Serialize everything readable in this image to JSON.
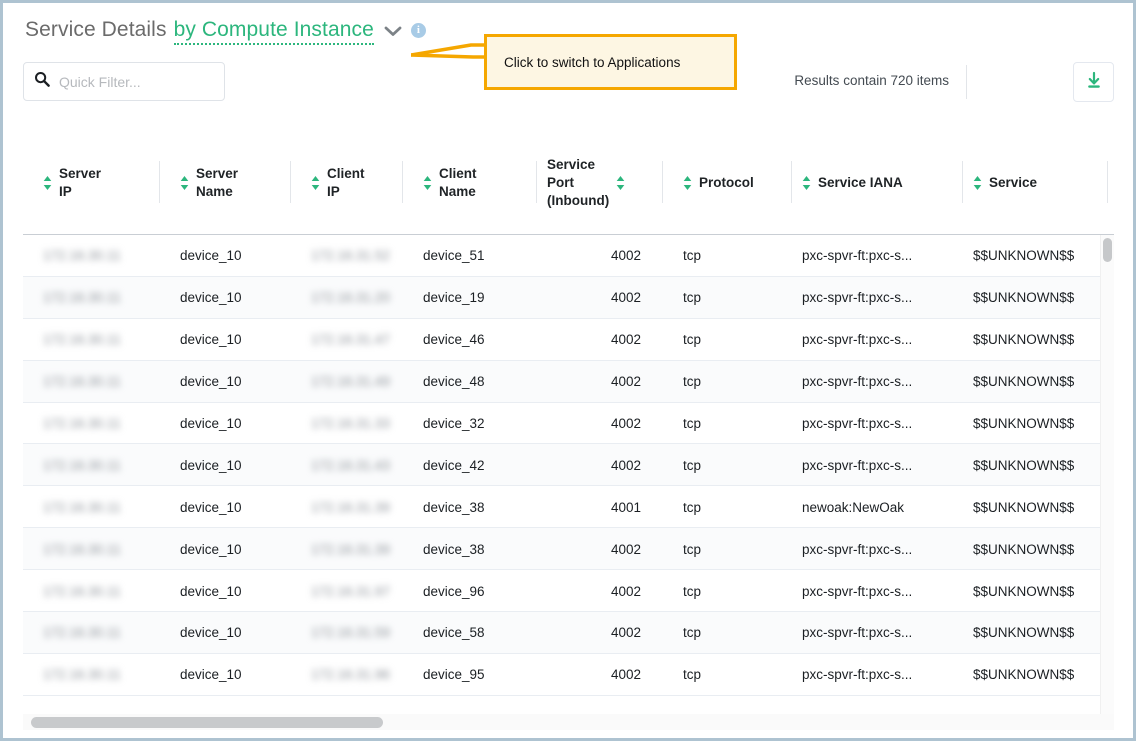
{
  "header": {
    "title_static": "Service Details",
    "title_link": "by Compute Instance",
    "chevron_icon": "chevron-down-icon",
    "info_icon": "info-icon",
    "info_glyph": "i"
  },
  "tooltip": {
    "text": "Click to switch to Applications",
    "border_color": "#f5a700",
    "background_color": "#fdf6e3"
  },
  "search": {
    "icon": "search-icon",
    "placeholder": "Quick Filter...",
    "value": ""
  },
  "toolbar": {
    "results_text": "Results contain 720 items",
    "download_icon": "download-icon",
    "accent_color": "#2cb67d"
  },
  "table": {
    "columns": [
      {
        "label": "Server\nIP",
        "line1": "Server",
        "line2": "IP",
        "sortable": true,
        "sorter_side": "left",
        "align": "left"
      },
      {
        "label": "Server\nName",
        "line1": "Server",
        "line2": "Name",
        "sortable": true,
        "sorter_side": "left",
        "align": "left"
      },
      {
        "label": "Client\nIP",
        "line1": "Client",
        "line2": "IP",
        "sortable": true,
        "sorter_side": "left",
        "align": "left"
      },
      {
        "label": "Client\nName",
        "line1": "Client",
        "line2": "Name",
        "sortable": true,
        "sorter_side": "left",
        "align": "left"
      },
      {
        "label": "Service Port (Inbound)",
        "line1": "Service",
        "line2": "Port",
        "line3": "(Inbound)",
        "sortable": true,
        "sorter_side": "right",
        "align": "right"
      },
      {
        "label": "Protocol",
        "line1": "Protocol",
        "sortable": true,
        "sorter_side": "left",
        "align": "left"
      },
      {
        "label": "Service IANA",
        "line1": "Service IANA",
        "sortable": true,
        "sorter_side": "left",
        "align": "left"
      },
      {
        "label": "Service",
        "line1": "Service",
        "sortable": true,
        "sorter_side": "left",
        "align": "left"
      }
    ],
    "rows": [
      {
        "server_ip": "172.16.30.11",
        "server_name": "device_10",
        "client_ip": "172.16.31.52",
        "client_name": "device_51",
        "service_port": "4002",
        "protocol": "tcp",
        "service_iana": "pxc-spvr-ft:pxc-s...",
        "service": "$$UNKNOWN$$"
      },
      {
        "server_ip": "172.16.30.11",
        "server_name": "device_10",
        "client_ip": "172.16.31.20",
        "client_name": "device_19",
        "service_port": "4002",
        "protocol": "tcp",
        "service_iana": "pxc-spvr-ft:pxc-s...",
        "service": "$$UNKNOWN$$"
      },
      {
        "server_ip": "172.16.30.11",
        "server_name": "device_10",
        "client_ip": "172.16.31.47",
        "client_name": "device_46",
        "service_port": "4002",
        "protocol": "tcp",
        "service_iana": "pxc-spvr-ft:pxc-s...",
        "service": "$$UNKNOWN$$"
      },
      {
        "server_ip": "172.16.30.11",
        "server_name": "device_10",
        "client_ip": "172.16.31.49",
        "client_name": "device_48",
        "service_port": "4002",
        "protocol": "tcp",
        "service_iana": "pxc-spvr-ft:pxc-s...",
        "service": "$$UNKNOWN$$"
      },
      {
        "server_ip": "172.16.30.11",
        "server_name": "device_10",
        "client_ip": "172.16.31.33",
        "client_name": "device_32",
        "service_port": "4002",
        "protocol": "tcp",
        "service_iana": "pxc-spvr-ft:pxc-s...",
        "service": "$$UNKNOWN$$"
      },
      {
        "server_ip": "172.16.30.11",
        "server_name": "device_10",
        "client_ip": "172.16.31.43",
        "client_name": "device_42",
        "service_port": "4002",
        "protocol": "tcp",
        "service_iana": "pxc-spvr-ft:pxc-s...",
        "service": "$$UNKNOWN$$"
      },
      {
        "server_ip": "172.16.30.11",
        "server_name": "device_10",
        "client_ip": "172.16.31.39",
        "client_name": "device_38",
        "service_port": "4001",
        "protocol": "tcp",
        "service_iana": "newoak:NewOak",
        "service": "$$UNKNOWN$$"
      },
      {
        "server_ip": "172.16.30.11",
        "server_name": "device_10",
        "client_ip": "172.16.31.39",
        "client_name": "device_38",
        "service_port": "4002",
        "protocol": "tcp",
        "service_iana": "pxc-spvr-ft:pxc-s...",
        "service": "$$UNKNOWN$$"
      },
      {
        "server_ip": "172.16.30.11",
        "server_name": "device_10",
        "client_ip": "172.16.31.97",
        "client_name": "device_96",
        "service_port": "4002",
        "protocol": "tcp",
        "service_iana": "pxc-spvr-ft:pxc-s...",
        "service": "$$UNKNOWN$$"
      },
      {
        "server_ip": "172.16.30.11",
        "server_name": "device_10",
        "client_ip": "172.16.31.59",
        "client_name": "device_58",
        "service_port": "4002",
        "protocol": "tcp",
        "service_iana": "pxc-spvr-ft:pxc-s...",
        "service": "$$UNKNOWN$$"
      },
      {
        "server_ip": "172.16.30.11",
        "server_name": "device_10",
        "client_ip": "172.16.31.96",
        "client_name": "device_95",
        "service_port": "4002",
        "protocol": "tcp",
        "service_iana": "pxc-spvr-ft:pxc-s...",
        "service": "$$UNKNOWN$$"
      }
    ]
  },
  "scrollbars": {
    "vertical_thumb": "vertical-scrollbar-thumb",
    "horizontal_thumb": "horizontal-scrollbar-thumb"
  }
}
